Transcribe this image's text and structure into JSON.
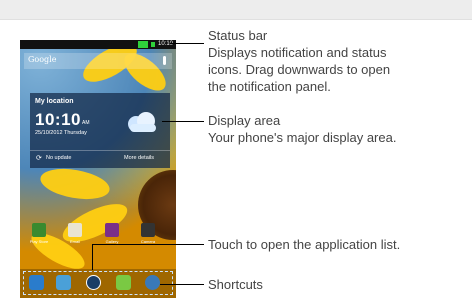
{
  "phone": {
    "status_time": "10:10",
    "search_label": "Google",
    "widget": {
      "location": "My location",
      "time": "10:10",
      "ampm": "AM",
      "date": "25/10/2012  Thursday",
      "no_update": "No update",
      "more_details": "More details"
    },
    "apps": [
      {
        "label": "Play Store",
        "color": "#3a8a2f"
      },
      {
        "label": "Email",
        "color": "#e9e4d2"
      },
      {
        "label": "Gallery",
        "color": "#7a2f8a"
      },
      {
        "label": "Camera",
        "color": "#333333"
      }
    ],
    "dock": [
      {
        "name": "phone-icon",
        "color": "#2a7ccc"
      },
      {
        "name": "contacts-icon",
        "color": "#4aa0d8"
      },
      {
        "name": "app-list-icon",
        "color": "#1b3e66"
      },
      {
        "name": "messaging-icon",
        "color": "#7ac943"
      },
      {
        "name": "browser-icon",
        "color": "#3a79b8"
      }
    ]
  },
  "callouts": {
    "status_bar_title": "Status bar",
    "status_bar_desc_1": "Displays notification and status",
    "status_bar_desc_2": "icons. Drag downwards to open",
    "status_bar_desc_3": "the notification panel.",
    "display_area_title": "Display area",
    "display_area_desc": "Your phone's major display area.",
    "app_list": "Touch to open the application list.",
    "shortcuts": "Shortcuts"
  }
}
